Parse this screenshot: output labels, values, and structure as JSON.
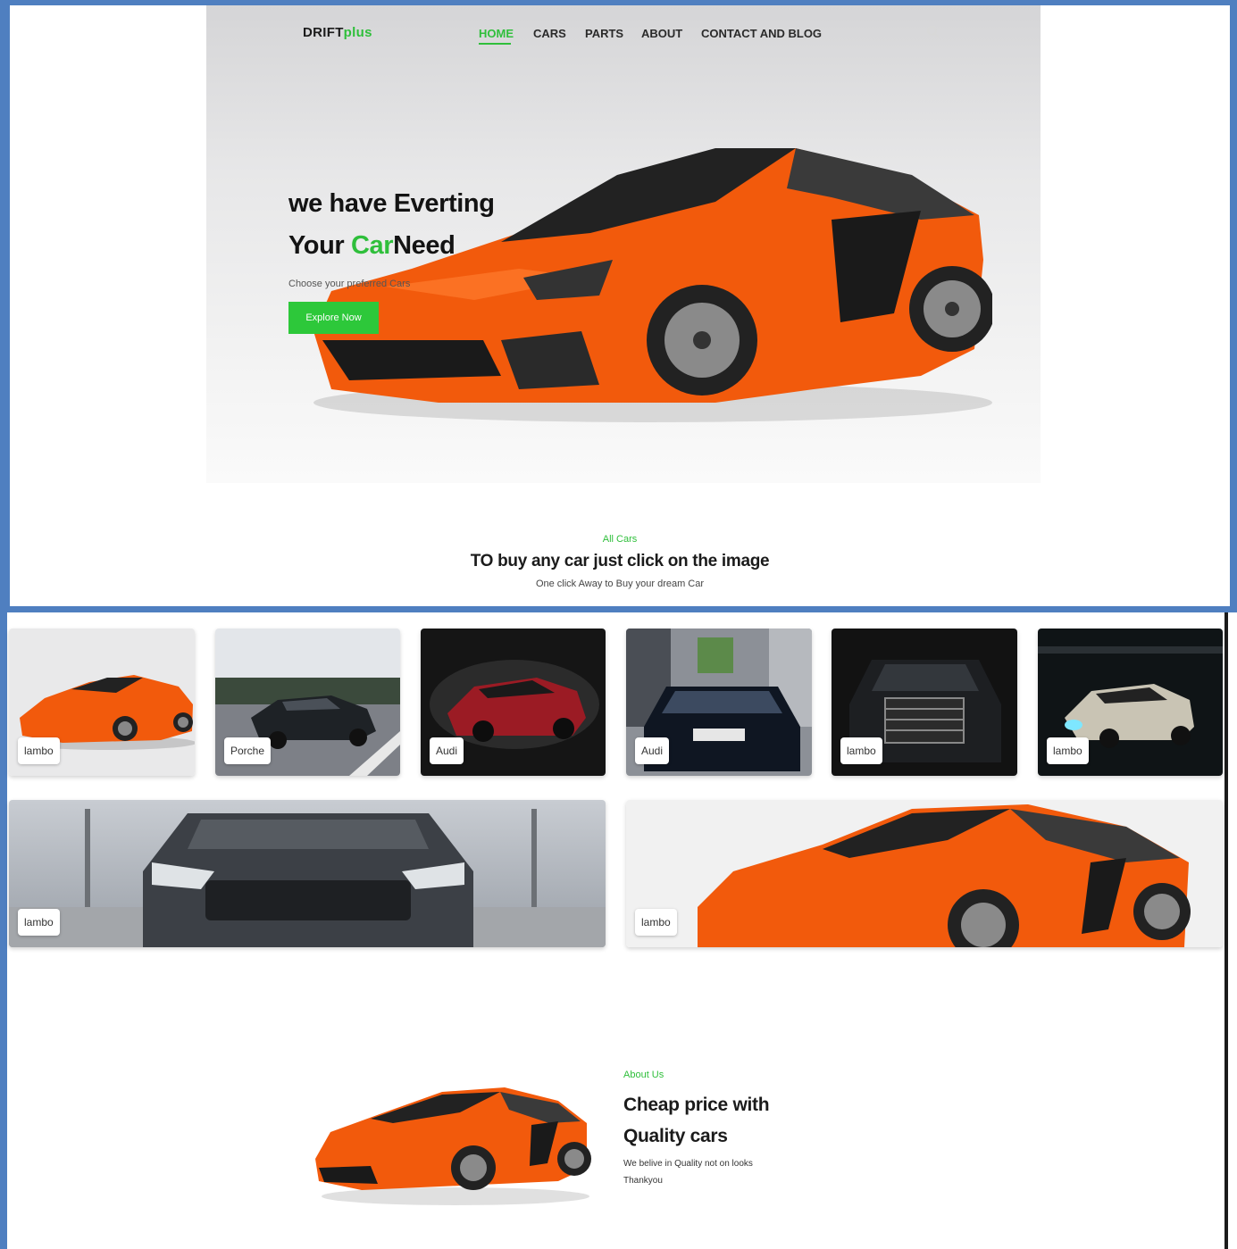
{
  "nav": {
    "logo_main": "DRIFT",
    "logo_accent": "plus",
    "items": [
      {
        "label": "HOME",
        "active": true
      },
      {
        "label": "CARS"
      },
      {
        "label": "PARTS"
      },
      {
        "label": "ABOUT"
      },
      {
        "label": "CONTACT AND BLOG"
      }
    ],
    "search_icon": "search-icon"
  },
  "hero": {
    "heading_line1": "we have Everting",
    "heading_line2_a": "Your ",
    "heading_line2_accent": "Car",
    "heading_line2_b": "Need",
    "subtitle": "Choose your preferred Cars",
    "cta_label": "Explore Now"
  },
  "all_cars": {
    "kicker": "All Cars",
    "title": "TO buy any car just click on the image",
    "subtitle": "One click Away to Buy your dream Car"
  },
  "gallery": {
    "row1": [
      {
        "label": "lambo"
      },
      {
        "label": "Porche"
      },
      {
        "label": "Audi"
      },
      {
        "label": "Audi"
      },
      {
        "label": "lambo"
      },
      {
        "label": "lambo"
      }
    ],
    "row2": [
      {
        "label": "lambo"
      },
      {
        "label": "lambo"
      }
    ]
  },
  "about": {
    "kicker": "About Us",
    "title_line1": "Cheap price with",
    "title_line2": "Quality cars",
    "text_line1": "We belive in Quality not on looks",
    "text_line2": "Thankyou"
  },
  "colors": {
    "accent": "#2fbf3b",
    "frame": "#4f7fc0",
    "car_orange": "#f25a0c"
  }
}
